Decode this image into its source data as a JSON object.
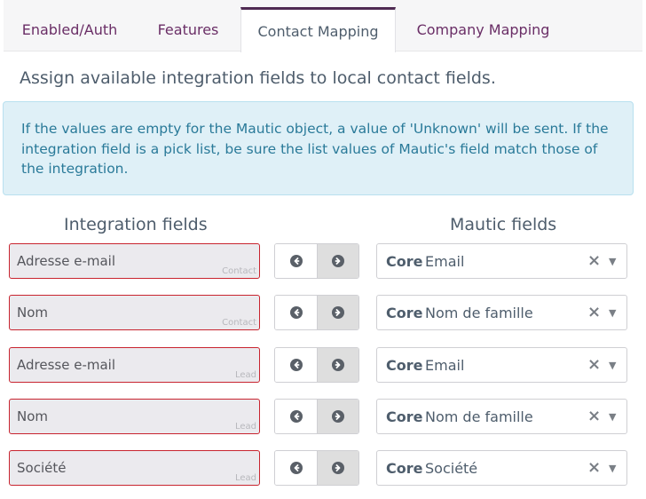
{
  "tabs": [
    {
      "label": "Enabled/Auth",
      "active": false
    },
    {
      "label": "Features",
      "active": false
    },
    {
      "label": "Contact Mapping",
      "active": true
    },
    {
      "label": "Company Mapping",
      "active": false
    }
  ],
  "intro": "Assign available integration fields to local contact fields.",
  "alert": "If the values are empty for the Mautic object, a value of 'Unknown' will be sent. If the integration field is a pick list, be sure the list values of Mautic's field match those of the integration.",
  "columns": {
    "integration": "Integration fields",
    "mautic": "Mautic fields"
  },
  "rows": [
    {
      "integration_field": "Adresse e-mail",
      "object": "Contact",
      "group": "Core",
      "mautic_field": "Email",
      "direction": "right"
    },
    {
      "integration_field": "Nom",
      "object": "Contact",
      "group": "Core",
      "mautic_field": "Nom de famille",
      "direction": "right"
    },
    {
      "integration_field": "Adresse e-mail",
      "object": "Lead",
      "group": "Core",
      "mautic_field": "Email",
      "direction": "right"
    },
    {
      "integration_field": "Nom",
      "object": "Lead",
      "group": "Core",
      "mautic_field": "Nom de famille",
      "direction": "right"
    },
    {
      "integration_field": "Société",
      "object": "Lead",
      "group": "Core",
      "mautic_field": "Société",
      "direction": "right"
    }
  ],
  "icons": {
    "left": "arrow-left-circle-icon",
    "right": "arrow-right-circle-icon",
    "clear": "clear-x-icon",
    "caret": "caret-down-icon"
  }
}
